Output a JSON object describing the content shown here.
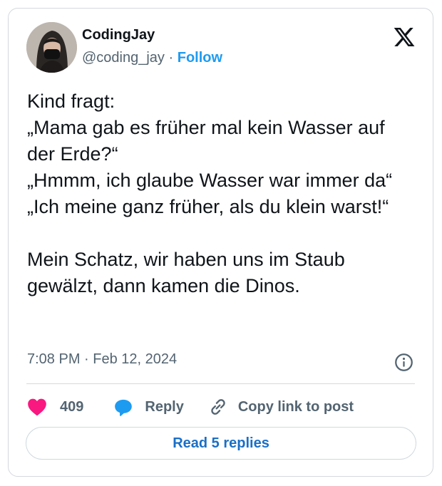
{
  "author": {
    "name": "CodingJay",
    "handle": "@coding_jay",
    "separator": "·",
    "follow_label": "Follow"
  },
  "tweet": {
    "lines_block1": [
      "Kind fragt:",
      "„Mama gab es früher mal kein Wasser auf der Erde?“",
      "„Hmmm, ich glaube Wasser war immer da“",
      "„Ich meine ganz früher, als du klein warst!“"
    ],
    "lines_block2": [
      "Mein Schatz, wir haben uns im Staub gewälzt, dann kamen die Dinos."
    ]
  },
  "meta": {
    "time": "7:08 PM",
    "separator": "·",
    "date": "Feb 12, 2024"
  },
  "actions": {
    "likes_count": "409",
    "reply_label": "Reply",
    "copy_link_label": "Copy link to post"
  },
  "read_replies_label": "Read 5 replies",
  "colors": {
    "accent": "#1d9bf0",
    "heart": "#f91880",
    "read_replies_text": "#1a6fc7",
    "secondary_text": "#536471"
  },
  "icons": {
    "brand": "x-logo-icon",
    "info": "info-icon",
    "like": "heart-icon",
    "reply": "speech-bubble-icon",
    "copy": "link-icon"
  }
}
